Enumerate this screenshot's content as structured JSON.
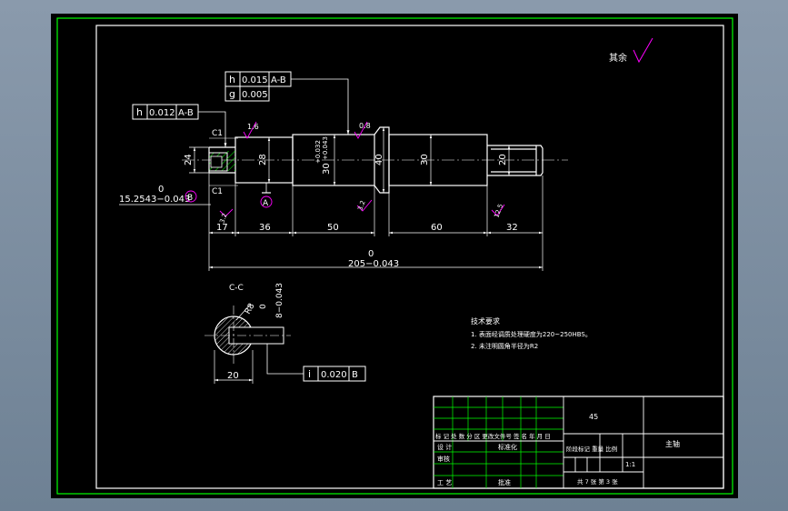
{
  "colors": {
    "canvas": "#000000",
    "frame_outer": "#00ff00",
    "frame_inner": "#ffffff",
    "dim": "#ffffff",
    "symbol": "#ff00ff",
    "hatch": "#00ff00",
    "accent_blue": "#6b7cff"
  },
  "drawing": {
    "corner_note": "其余",
    "fcf_runout_top": {
      "sym": "h",
      "val": "0.015",
      "ref": "A-B"
    },
    "fcf_cyl": {
      "sym": "g",
      "val": "0.005"
    },
    "fcf_runout_left": {
      "sym": "h",
      "val": "0.012",
      "ref": "A-B"
    },
    "fcf_sym": {
      "sym": "i",
      "val": "0.020",
      "ref": "B"
    },
    "chamfer_top": "C1",
    "chamfer_bottom": "C1",
    "dim_24": "24",
    "dim_28": "28",
    "dim_30_tol_main": "30",
    "dim_30_tol_upper": "+0.032",
    "dim_30_tol_lower": "+0.043",
    "dim_40": "40",
    "dim_30": "30",
    "dim_20": "20",
    "dim_17": "17",
    "dim_36": "36",
    "dim_50": "50",
    "dim_60": "60",
    "dim_32": "32",
    "dim_len_upper": "0",
    "dim_len_main": "205−0.043",
    "dim_left_upper": "0",
    "dim_left_main": "15.2543−0.043",
    "datum_a": "A",
    "datum_b": "B",
    "rough_16": "1.6",
    "rough_08": "0.8",
    "rough_32a": "3.2",
    "rough_32b": "3.2",
    "rough_32c": "3.2",
    "rough_125": "12.5",
    "section_title": "C-C",
    "sec_dim_r": "R8",
    "sec_dim_key_upper": "0",
    "sec_dim_key_main": "8−0.043",
    "sec_dim_20": "20"
  },
  "notes": {
    "title": "技术要求",
    "line1": "1. 表面经调质处理硬度为220~250HBS。",
    "line2": "2. 未注明圆角半径为R2"
  },
  "title_block": {
    "material": "45",
    "name": "主轴",
    "row_header": "标 记 处 数  分  区  更改文件号  签 名  年 月 日",
    "design": "设 计",
    "std": "标准化",
    "check": "审核",
    "process": "工 艺",
    "approve": "批准",
    "stage_labels": "阶段标记   重量  比例",
    "scale": "1:1",
    "sheets": "共 7 张  第 3 张"
  }
}
